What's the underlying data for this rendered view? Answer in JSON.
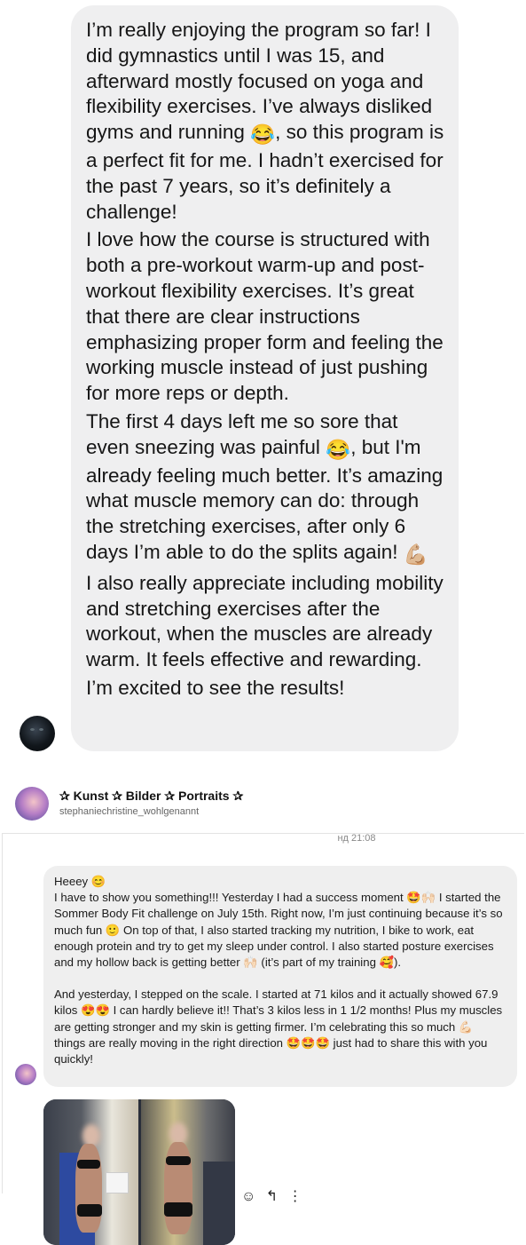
{
  "first_message": {
    "paragraphs": [
      "I’m really enjoying the program so far! I did gymnastics until I was 15, and afterward mostly focused on yoga and flexibility exercises. I’ve always disliked gyms and running",
      "I love how the course is structured with both a pre-workout warm-up and post-workout flexibility exercises. It’s great that there are clear instructions emphasizing proper form and feeling the working muscle instead of just pushing for more reps or depth.",
      "The first 4 days left me so sore that even sneezing was painful",
      "I also really appreciate including mobility and stretching exercises after the workout, when the muscles are already warm. It feels effective and rewarding.",
      "I’m excited to see the results!"
    ],
    "p1_tail": ", so this program is a perfect fit for me. I hadn’t exercised for the past 7 years, so it’s definitely a challenge!",
    "p3_tail": ", but I'm already feeling much better. It’s amazing what muscle memory can do: through the stretching exercises, after only 6 days I’m able to do the splits again!",
    "emojis": {
      "laugh": "😂",
      "flex": "💪🏼"
    }
  },
  "header": {
    "name": "✰ Kunst ✰ Bilder ✰ Portraits ✰",
    "handle": "stephaniechristine_wohlgenannt"
  },
  "timestamp": "нд 21:08",
  "second_message": {
    "greeting": "Heeey",
    "p1_a": "I have to show you something!!! Yesterday I had a success moment",
    "p1_b": "I started the Sommer Body Fit challenge on July 15th. Right now, I’m just continuing because it’s so much fun",
    "p1_c": "On top of that, I also started tracking my nutrition, I bike to work, eat enough protein and try to get my sleep under control. I also started posture exercises and my hollow back is getting better",
    "p1_d": "(it’s part of my training",
    "p1_e": ").",
    "p2_a": "And yesterday, I stepped on the scale. I started at 71 kilos and it actually showed 67.9 kilos",
    "p2_b": "I can hardly believe it!! That’s 3 kilos less in 1 1/2 months! Plus my muscles are getting stronger and my skin is getting firmer. I’m celebrating this so much",
    "p2_c": "things are really moving in the right direction",
    "p2_d": "just had to share this with you quickly!",
    "emojis": {
      "grin": "😊",
      "star_eyes": "🤩",
      "pray": "🙌🏻",
      "slight_smile": "🙂",
      "hands": "🙌🏻",
      "hearts": "🥰",
      "heart_eyes": "😍😍",
      "muscle": "💪🏻",
      "star_eyes_3": "🤩🤩🤩"
    }
  },
  "actions": {
    "react": "☺",
    "reply": "↰",
    "more": "⋮"
  }
}
